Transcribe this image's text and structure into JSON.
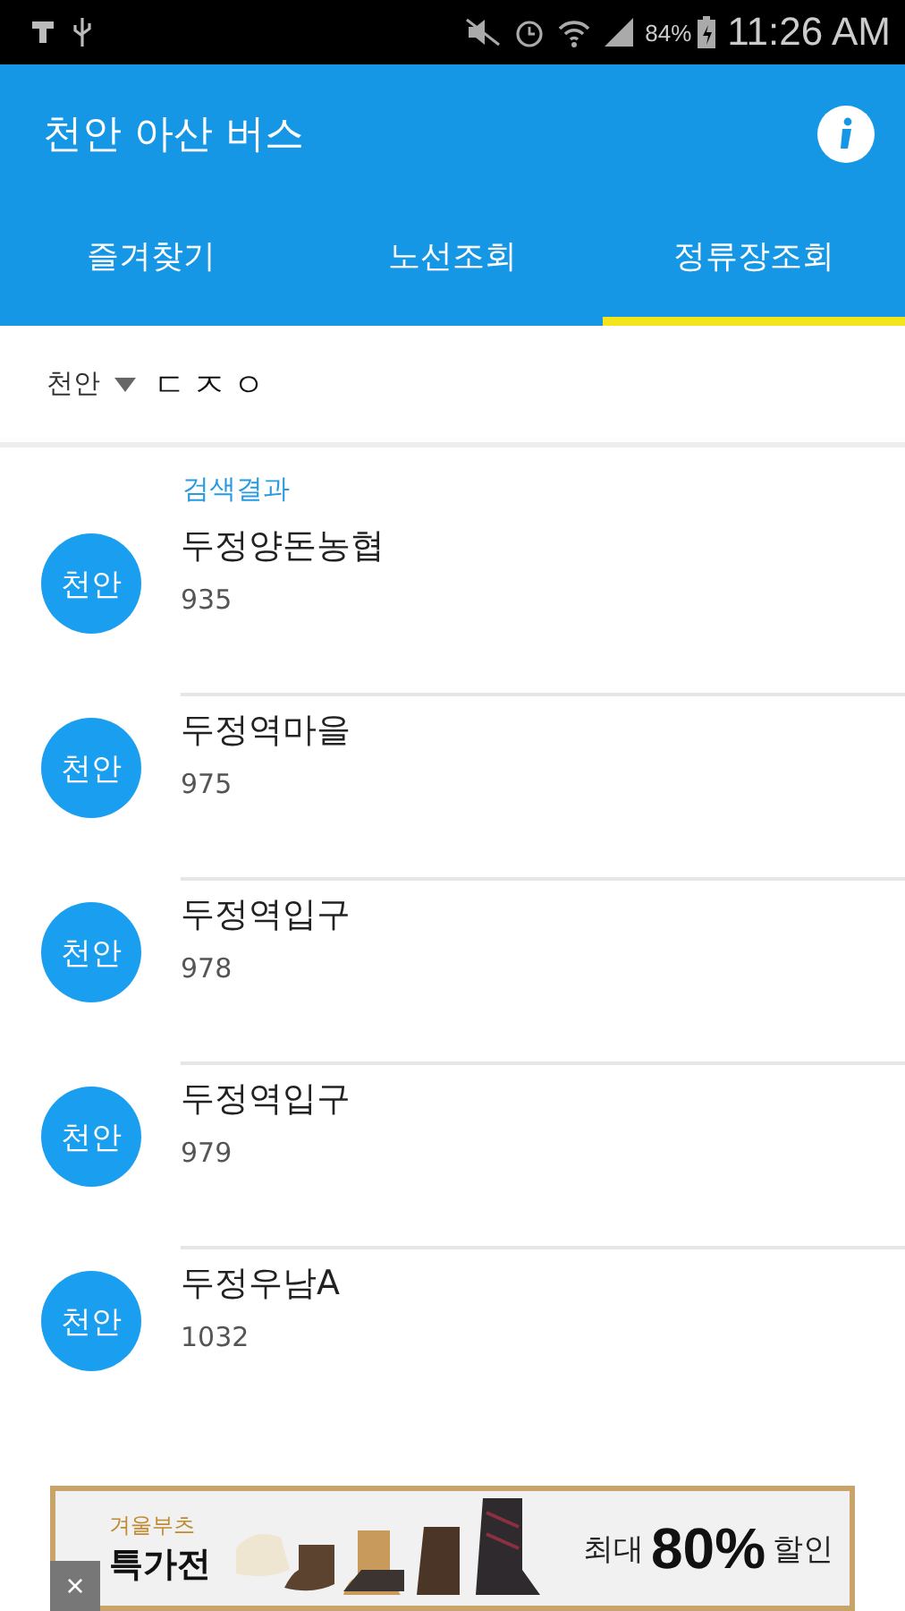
{
  "status_bar": {
    "battery_text": "84%",
    "time": "11:26 AM"
  },
  "app_bar": {
    "title": "천안 아산 버스"
  },
  "tabs": [
    {
      "label": "즐겨찾기",
      "selected": false
    },
    {
      "label": "노선조회",
      "selected": false
    },
    {
      "label": "정류장조회",
      "selected": true
    }
  ],
  "search": {
    "region": "천안",
    "value": "ㄷㅈㅇ"
  },
  "results": {
    "heading": "검색결과",
    "items": [
      {
        "city": "천안",
        "name": "두정양돈농협",
        "number": "935"
      },
      {
        "city": "천안",
        "name": "두정역마을",
        "number": "975"
      },
      {
        "city": "천안",
        "name": "두정역입구",
        "number": "978"
      },
      {
        "city": "천안",
        "name": "두정역입구",
        "number": "979"
      },
      {
        "city": "천안",
        "name": "두정우남A",
        "number": "1032"
      }
    ]
  },
  "ad": {
    "tagline": "겨울부츠",
    "headline": "특가전",
    "prefix": "최대",
    "discount": "80%",
    "suffix": "할인",
    "close": "×"
  }
}
